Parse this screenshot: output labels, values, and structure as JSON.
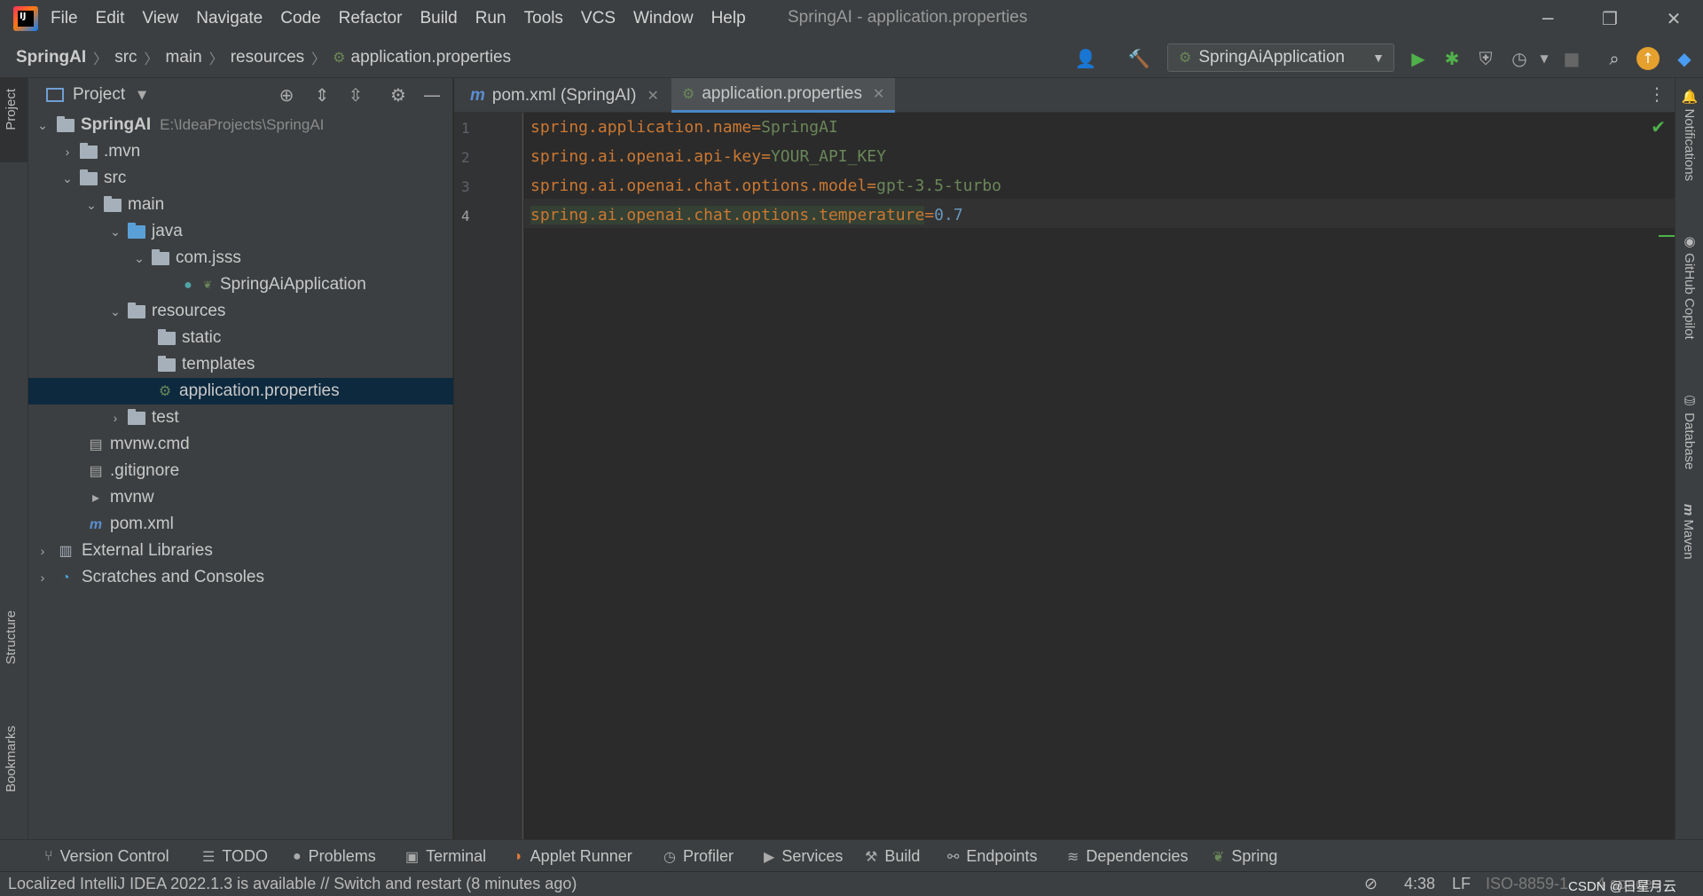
{
  "app": {
    "window_title": "SpringAI - application.properties",
    "menu": [
      "File",
      "Edit",
      "View",
      "Navigate",
      "Code",
      "Refactor",
      "Build",
      "Run",
      "Tools",
      "VCS",
      "Window",
      "Help"
    ]
  },
  "breadcrumb": [
    "SpringAI",
    "src",
    "main",
    "resources",
    "application.properties"
  ],
  "run_config": "SpringAiApplication",
  "left_stripe": [
    "Project",
    "Structure",
    "Bookmarks"
  ],
  "project_panel": {
    "title": "Project",
    "tree": [
      {
        "label": "SpringAI",
        "hint": "E:\\IdeaProjects\\SpringAI"
      },
      {
        "label": ".mvn"
      },
      {
        "label": "src"
      },
      {
        "label": "main"
      },
      {
        "label": "java"
      },
      {
        "label": "com.jsss"
      },
      {
        "label": "SpringAiApplication"
      },
      {
        "label": "resources"
      },
      {
        "label": "static"
      },
      {
        "label": "templates"
      },
      {
        "label": "application.properties"
      },
      {
        "label": "test"
      },
      {
        "label": "mvnw.cmd"
      },
      {
        "label": ".gitignore"
      },
      {
        "label": "mvnw"
      },
      {
        "label": "pom.xml"
      },
      {
        "label": "External Libraries"
      },
      {
        "label": "Scratches and Consoles"
      }
    ]
  },
  "editor": {
    "tabs": [
      "pom.xml (SpringAI)",
      "application.properties"
    ],
    "lines": [
      {
        "num": "1",
        "key": "spring.application.name",
        "eq": "=",
        "value": "SpringAI"
      },
      {
        "num": "2",
        "key": "spring.ai.openai.api-key",
        "eq": "=",
        "value": "YOUR_API_KEY"
      },
      {
        "num": "3",
        "key": "spring.ai.openai.chat.options.model",
        "eq": "=",
        "value": "gpt-3.5-turbo"
      },
      {
        "num": "4",
        "key": "spring.ai.openai.chat.options.temperature",
        "eq": "=",
        "value": "0.7"
      }
    ]
  },
  "right_stripe": [
    "Notifications",
    "GitHub Copilot",
    "Database",
    "Maven"
  ],
  "bottom_tools": [
    "Version Control",
    "TODO",
    "Problems",
    "Terminal",
    "Applet Runner",
    "Profiler",
    "Services",
    "Build",
    "Endpoints",
    "Dependencies",
    "Spring"
  ],
  "status": {
    "message": "Localized IntelliJ IDEA 2022.1.3 is available // Switch and restart (8 minutes ago)",
    "position": "4:38",
    "line_sep": "LF",
    "encoding": "ISO-8859-1",
    "indent": "4 spaces",
    "watermark": "CSDN @日星月云"
  },
  "colors": {
    "key": "#cc7832",
    "string_value": "#6a8759",
    "number_value": "#6897bb",
    "selection": "#0d293e",
    "accent": "#4a88c7"
  }
}
